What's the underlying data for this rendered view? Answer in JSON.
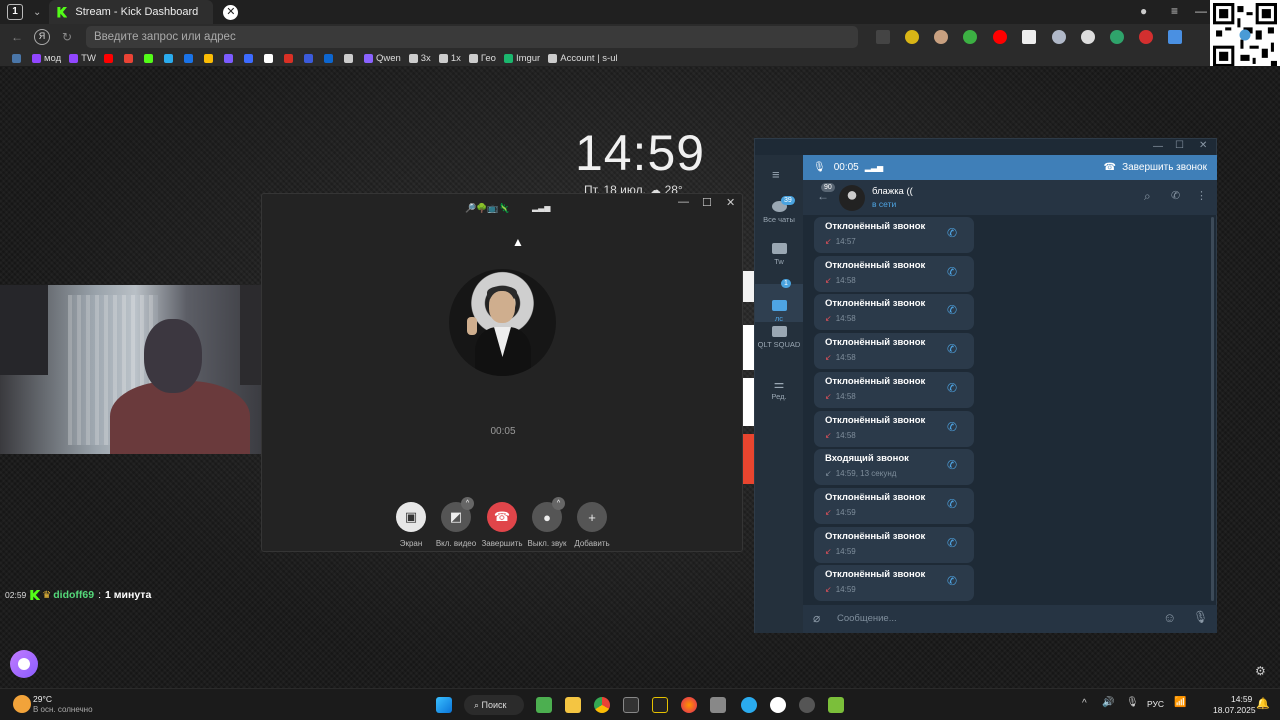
{
  "browser": {
    "tab_count": "1",
    "tab_title": "Stream - Kick Dashboard",
    "address_placeholder": "Введите запрос или адрес",
    "bookmarks": [
      {
        "label": "",
        "color": "#4a76a8"
      },
      {
        "label": "мод",
        "color": "#9146ff"
      },
      {
        "label": "TW",
        "color": "#9146ff"
      },
      {
        "label": "",
        "color": "#ff0000"
      },
      {
        "label": "",
        "color": "#ea4335"
      },
      {
        "label": "",
        "color": "#53fc18"
      },
      {
        "label": "",
        "color": "#2aabee"
      },
      {
        "label": "",
        "color": "#1a73e8"
      },
      {
        "label": "",
        "color": "#fbbc05"
      },
      {
        "label": "",
        "color": "#7b5cff"
      },
      {
        "label": "",
        "color": "#3d6bff"
      },
      {
        "label": "",
        "color": "#ffffff"
      },
      {
        "label": "",
        "color": "#d93025"
      },
      {
        "label": "",
        "color": "#3b5bdb"
      },
      {
        "label": "",
        "color": "#0d66d0"
      },
      {
        "label": "",
        "color": "#cccccc"
      },
      {
        "label": "Qwen",
        "color": "#8a63ff"
      },
      {
        "label": "3x",
        "color": "#cccccc"
      },
      {
        "label": "1x",
        "color": "#cccccc"
      },
      {
        "label": "Гео",
        "color": "#cccccc"
      },
      {
        "label": "Imgur",
        "color": "#1bb76e"
      },
      {
        "label": "Account | s-ul",
        "color": "#cccccc"
      }
    ]
  },
  "desktop": {
    "clock": "14:59",
    "date_weather": "Пт, 18 июл. ☁ 28°"
  },
  "call_window": {
    "timer": "00:05",
    "buttons": [
      {
        "label": "Экран",
        "icon": "screen-share-icon"
      },
      {
        "label": "Вкл. видео",
        "icon": "video-off-icon"
      },
      {
        "label": "Завершить",
        "icon": "hang-up-icon"
      },
      {
        "label": "Выкл. звук",
        "icon": "mic-icon"
      },
      {
        "label": "Добавить",
        "icon": "add-user-icon"
      }
    ]
  },
  "stream_chat": {
    "time": "02:59",
    "username": "didoff69",
    "message": "1 минута"
  },
  "telegram": {
    "call_bar": {
      "timer": "00:05",
      "end_label": "Завершить звонок"
    },
    "sidebar": [
      {
        "label": "Все чаты",
        "badge": "39"
      },
      {
        "label": "Tw",
        "badge": ""
      },
      {
        "label": "лс",
        "badge": "1"
      },
      {
        "label": "QLT SQUAD",
        "badge": ""
      },
      {
        "label": "Ред.",
        "badge": ""
      }
    ],
    "chat": {
      "name": "блажка ((",
      "status": "в сети",
      "back_badge": "90"
    },
    "messages": [
      {
        "title": "Отклонённый звонок",
        "sub": "14:57",
        "arrow": "missed"
      },
      {
        "title": "Отклонённый звонок",
        "sub": "14:58",
        "arrow": "missed"
      },
      {
        "title": "Отклонённый звонок",
        "sub": "14:58",
        "arrow": "missed"
      },
      {
        "title": "Отклонённый звонок",
        "sub": "14:58",
        "arrow": "missed"
      },
      {
        "title": "Отклонённый звонок",
        "sub": "14:58",
        "arrow": "missed"
      },
      {
        "title": "Отклонённый звонок",
        "sub": "14:58",
        "arrow": "missed"
      },
      {
        "title": "Входящий звонок",
        "sub": "14:59, 13 секунд",
        "arrow": "incoming"
      },
      {
        "title": "Отклонённый звонок",
        "sub": "14:59",
        "arrow": "missed"
      },
      {
        "title": "Отклонённый звонок",
        "sub": "14:59",
        "arrow": "missed"
      },
      {
        "title": "Отклонённый звонок",
        "sub": "14:59",
        "arrow": "missed"
      }
    ],
    "input_placeholder": "Сообщение..."
  },
  "taskbar": {
    "weather_temp": "29°C",
    "weather_desc": "В осн. солнечно",
    "search_label": "Поиск",
    "lang": "РУС",
    "time": "14:59",
    "date": "18.07.2025"
  }
}
